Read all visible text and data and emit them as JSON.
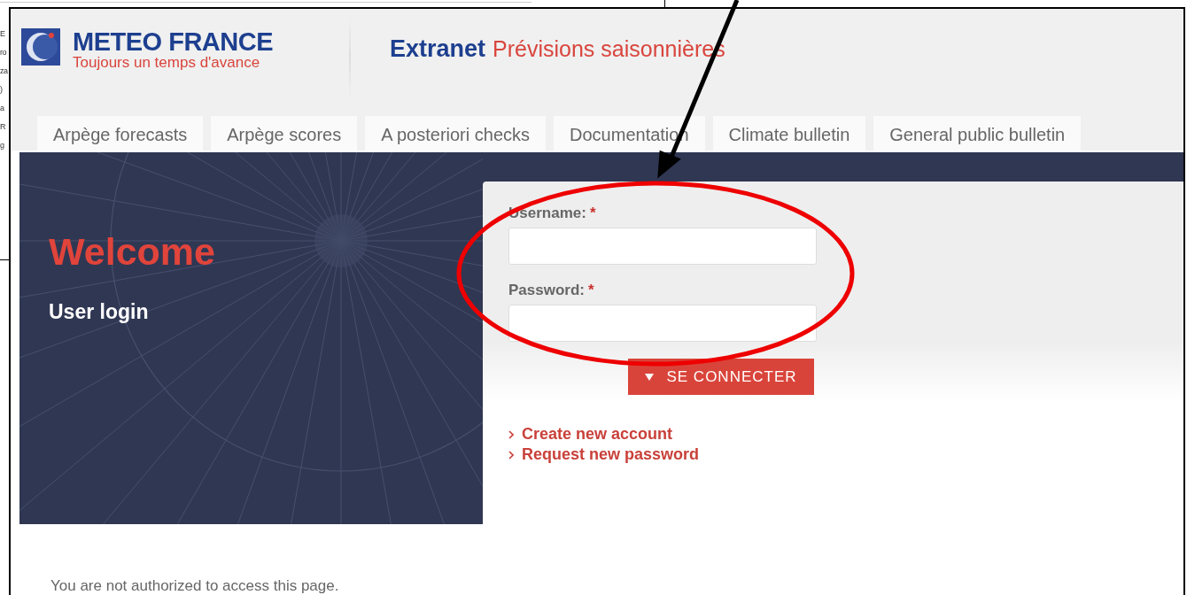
{
  "background_fragments": [
    "E",
    "ro",
    "za",
    ")",
    "a",
    "R",
    "g"
  ],
  "header": {
    "brand": "METEO FRANCE",
    "tagline": "Toujours un temps d'avance",
    "site_name": "Extranet",
    "site_section": "Prévisions saisonnières"
  },
  "tabs": [
    {
      "label": "Arpège forecasts"
    },
    {
      "label": "Arpège scores"
    },
    {
      "label": "A posteriori checks"
    },
    {
      "label": "Documentation"
    },
    {
      "label": "Climate bulletin"
    },
    {
      "label": "General public bulletin"
    }
  ],
  "banner": {
    "title": "Welcome",
    "subtitle": "User login"
  },
  "login_form": {
    "fields": [
      {
        "label": "Username:",
        "required_mark": "*"
      },
      {
        "label": "Password:",
        "required_mark": "*"
      }
    ],
    "submit": "SE CONNECTER",
    "links": [
      "Create new account",
      "Request new password"
    ]
  },
  "message": "You are not authorized to access this page."
}
